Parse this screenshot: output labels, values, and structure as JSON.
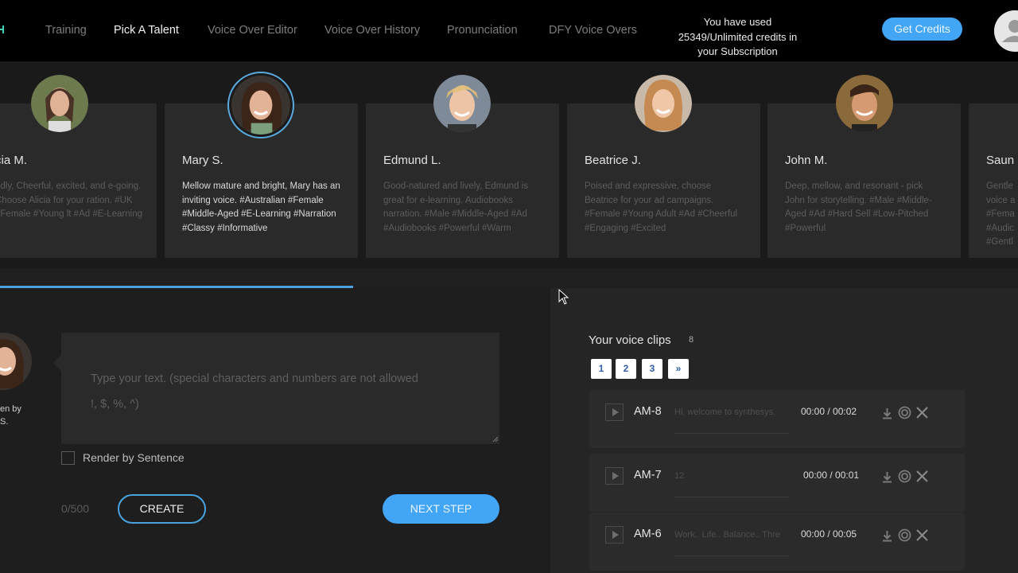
{
  "nav": {
    "items": [
      "Training",
      "Pick A Talent",
      "Voice Over Editor",
      "Voice Over History",
      "Pronunciation",
      "DFY Voice Overs"
    ],
    "active_index": 1,
    "credits_line1": "You have used",
    "credits_line2": "25349/Unlimited credits in",
    "credits_line3": "your Subscription",
    "get_credits_label": "Get Credits"
  },
  "talents": [
    {
      "name": "cia M.",
      "desc": "ndly, Cheerful, excited, and e-going. Choose Alicia for your ration. #UK #Female #Young lt #Ad #E-Learning"
    },
    {
      "name": "Mary S.",
      "desc": "Mellow mature and bright, Mary has an inviting voice. #Australian #Female #Middle-Aged #E-Learning #Narration #Classy #Informative",
      "selected": true
    },
    {
      "name": "Edmund L.",
      "desc": "Good-natured and lively, Edmund is great for e-learning. Audiobooks narration. #Male #Middle-Aged #Ad #Audiobooks #Powerful #Warm"
    },
    {
      "name": "Beatrice J.",
      "desc": "Poised and expressive, choose Beatrice for your ad campaigns. #Female #Young Adult #Ad #Cheerful #Engaging #Excited"
    },
    {
      "name": "John M.",
      "desc": "Deep, mellow, and resonant - pick John for storytelling. #Male #Middle-Aged #Ad #Hard Sell #Low-Pitched #Powerful"
    },
    {
      "name": "Saun",
      "desc": "Gentle voice a #Fema #Audic #Gentl"
    }
  ],
  "editor": {
    "speaker_line1": "en by",
    "speaker_line2": "S.",
    "placeholder_line1": "Type your text. (special characters and numbers are not allowed",
    "placeholder_line2": "!, $, %, ^)",
    "render_by_sentence": "Render by Sentence",
    "char_count": "0/500",
    "create_label": "CREATE",
    "next_step_label": "NEXT STEP"
  },
  "clips": {
    "title": "Your voice clips",
    "count": "8",
    "pages": [
      "1",
      "2",
      "3",
      "»"
    ],
    "items": [
      {
        "name": "AM-8",
        "text": "Hi, welcome to synthesys.",
        "time": "00:00 / 00:02"
      },
      {
        "name": "AM-7",
        "text": "12",
        "time": "00:00 / 00:01"
      },
      {
        "name": "AM-6",
        "text": "Work.. Life.. Balance.. Thre",
        "time": "00:00 / 00:05"
      }
    ]
  },
  "colors": {
    "accent": "#42a5f5",
    "nav_bg": "#000000",
    "card_bg": "#2a2a2b"
  }
}
